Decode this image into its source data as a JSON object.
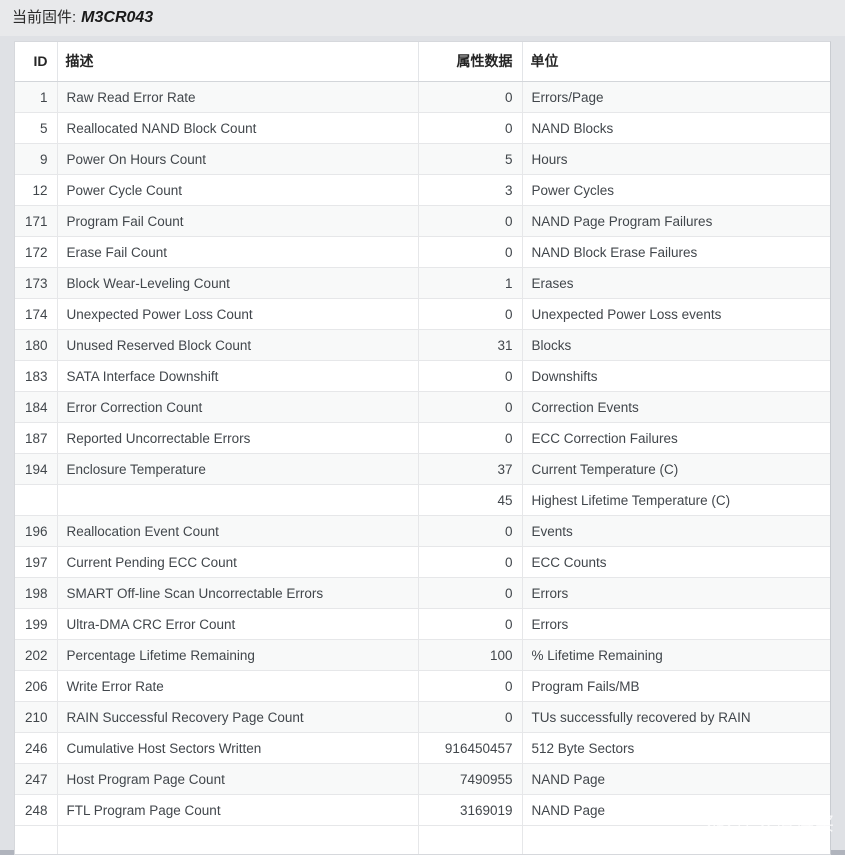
{
  "header": {
    "firmware_label": "当前固件:",
    "firmware_value": "M3CR043"
  },
  "table": {
    "columns": {
      "id": "ID",
      "description": "描述",
      "value": "属性数据",
      "unit": "单位"
    },
    "rows": [
      {
        "id": "1",
        "description": "Raw Read Error Rate",
        "value": "0",
        "unit": "Errors/Page"
      },
      {
        "id": "5",
        "description": "Reallocated NAND Block Count",
        "value": "0",
        "unit": "NAND Blocks"
      },
      {
        "id": "9",
        "description": "Power On Hours Count",
        "value": "5",
        "unit": "Hours"
      },
      {
        "id": "12",
        "description": "Power Cycle Count",
        "value": "3",
        "unit": "Power Cycles"
      },
      {
        "id": "171",
        "description": "Program Fail Count",
        "value": "0",
        "unit": "NAND Page Program Failures"
      },
      {
        "id": "172",
        "description": "Erase Fail Count",
        "value": "0",
        "unit": "NAND Block Erase Failures"
      },
      {
        "id": "173",
        "description": "Block Wear-Leveling Count",
        "value": "1",
        "unit": "Erases"
      },
      {
        "id": "174",
        "description": "Unexpected Power Loss Count",
        "value": "0",
        "unit": "Unexpected Power Loss events"
      },
      {
        "id": "180",
        "description": "Unused Reserved Block Count",
        "value": "31",
        "unit": "Blocks"
      },
      {
        "id": "183",
        "description": "SATA Interface Downshift",
        "value": "0",
        "unit": "Downshifts"
      },
      {
        "id": "184",
        "description": "Error Correction Count",
        "value": "0",
        "unit": "Correction Events"
      },
      {
        "id": "187",
        "description": "Reported Uncorrectable Errors",
        "value": "0",
        "unit": "ECC Correction Failures"
      },
      {
        "id": "194",
        "description": "Enclosure Temperature",
        "value": "37",
        "unit": "Current Temperature (C)"
      },
      {
        "id": "",
        "description": "",
        "value": "45",
        "unit": "Highest Lifetime Temperature (C)"
      },
      {
        "id": "196",
        "description": "Reallocation Event Count",
        "value": "0",
        "unit": "Events"
      },
      {
        "id": "197",
        "description": "Current Pending ECC Count",
        "value": "0",
        "unit": "ECC Counts"
      },
      {
        "id": "198",
        "description": "SMART Off-line Scan Uncorrectable Errors",
        "value": "0",
        "unit": "Errors"
      },
      {
        "id": "199",
        "description": "Ultra-DMA CRC Error Count",
        "value": "0",
        "unit": "Errors"
      },
      {
        "id": "202",
        "description": "Percentage Lifetime Remaining",
        "value": "100",
        "unit": "% Lifetime Remaining"
      },
      {
        "id": "206",
        "description": "Write Error Rate",
        "value": "0",
        "unit": "Program Fails/MB"
      },
      {
        "id": "210",
        "description": "RAIN Successful Recovery Page Count",
        "value": "0",
        "unit": "TUs successfully recovered by RAIN"
      },
      {
        "id": "246",
        "description": "Cumulative Host Sectors Written",
        "value": "916450457",
        "unit": "512 Byte Sectors"
      },
      {
        "id": "247",
        "description": "Host Program Page Count",
        "value": "7490955",
        "unit": "NAND Page"
      },
      {
        "id": "248",
        "description": "FTL Program Page Count",
        "value": "3169019",
        "unit": "NAND Page"
      }
    ]
  },
  "watermark": {
    "badge": "值",
    "text": "什么值得买"
  },
  "colors": {
    "page_background": "#dfe1e5",
    "titlebar_background": "#e8e9eb",
    "table_background": "#ffffff",
    "row_alt_background": "#f8f9f9",
    "text": "#41464b",
    "border": "#e6e7e9"
  }
}
